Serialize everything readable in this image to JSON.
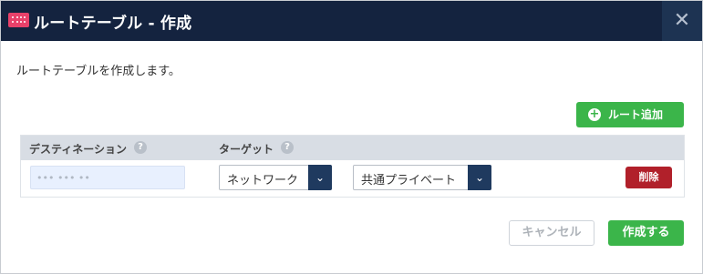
{
  "dialog": {
    "title": "ルートテーブル - 作成",
    "title_icon": "route-table-icon",
    "close_icon": "close-icon",
    "close_glyph": "✕",
    "description": "ルートテーブルを作成します。"
  },
  "toolbar": {
    "add_route_label": "ルート追加",
    "add_route_icon": "plus-circle-icon",
    "plus_glyph": "+"
  },
  "routes_table": {
    "columns": [
      {
        "label": "デスティネーション",
        "help_icon": "question-icon",
        "help_glyph": "?"
      },
      {
        "label": "ターゲット",
        "help_icon": "question-icon",
        "help_glyph": "?"
      }
    ],
    "rows": [
      {
        "destination_value": "••• ••• ••",
        "target_type": "ネットワーク",
        "target_value": "共通プライベート",
        "delete_label": "削除"
      }
    ],
    "dropdown_icon": "chevron-down-icon",
    "chevron_glyph": "⌄"
  },
  "footer": {
    "cancel_label": "キャンセル",
    "create_label": "作成する"
  },
  "colors": {
    "header_bg": "#14233f",
    "primary_green": "#3bb54a",
    "danger_red": "#b1202a",
    "select_arrow_bg": "#1f3a5f",
    "table_header_bg": "#d8dde4"
  }
}
